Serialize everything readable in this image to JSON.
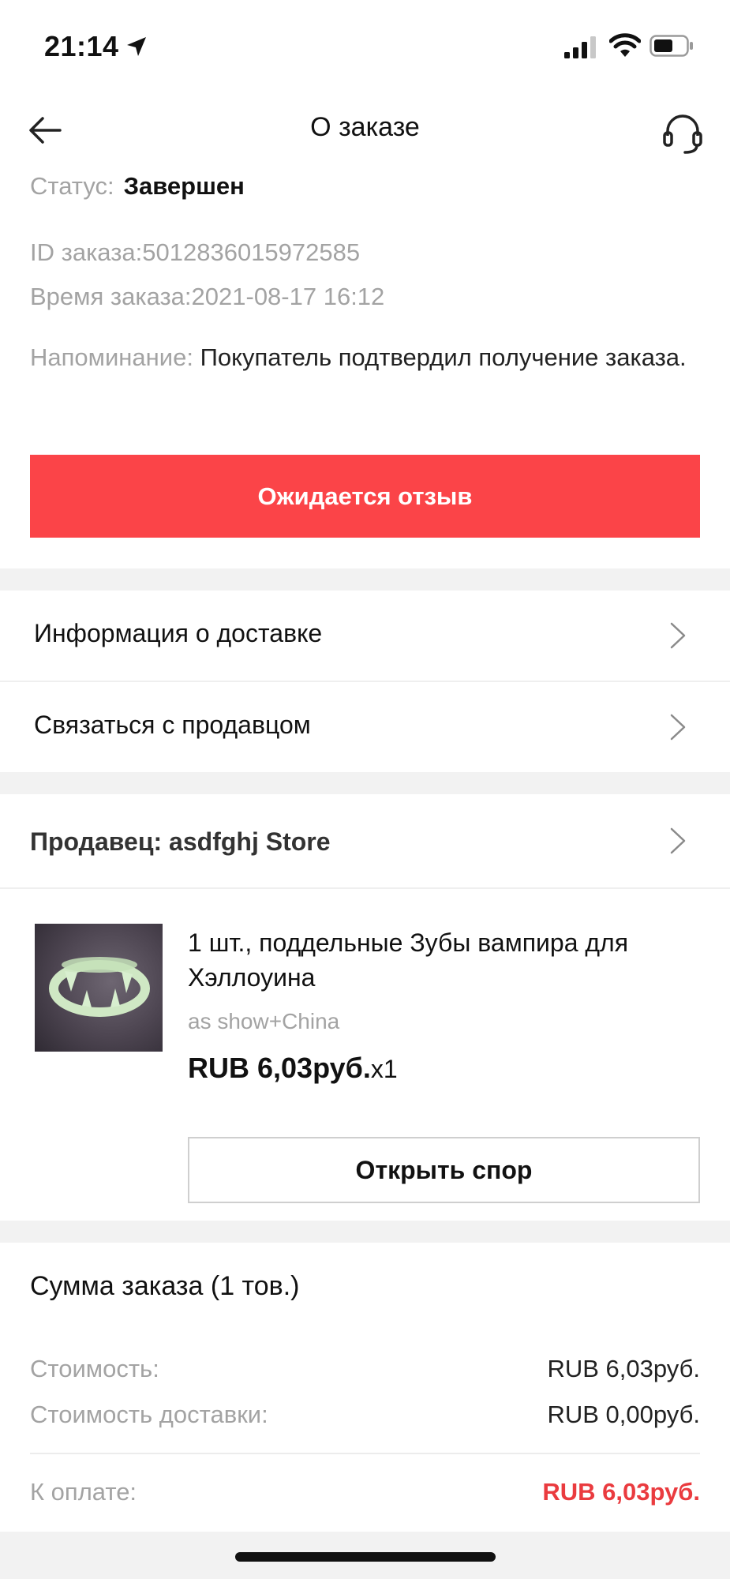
{
  "status_bar": {
    "time": "21:14",
    "icons": [
      "location-arrow-icon",
      "cellular-signal-icon",
      "wifi-icon",
      "battery-icon"
    ]
  },
  "nav": {
    "title": "О заказе",
    "back_icon": "arrow-left-icon",
    "support_icon": "headset-icon"
  },
  "order": {
    "status_label": "Статус:",
    "status_value": "Завершен",
    "id_line": "ID заказа:5012836015972585",
    "time_line": "Время заказа:2021-08-17 16:12",
    "reminder_label": "Напоминание:",
    "reminder_text": "Покупатель подтвердил получение заказа.",
    "review_button": "Ожидается отзыв"
  },
  "links": [
    {
      "label": "Информация о доставке"
    },
    {
      "label": "Связаться с продавцом"
    }
  ],
  "seller": {
    "label": "Продавец: asdfghj Store"
  },
  "product": {
    "title": "1 шт., поддельные Зубы вампира для Хэллоуина",
    "variant": "as show+China",
    "price": "RUB 6,03руб.",
    "quantity": "x1",
    "dispute_button": "Открыть спор"
  },
  "summary": {
    "title": "Сумма заказа (1 тов.)",
    "cost_label": "Стоимость:",
    "cost_value": "RUB 6,03руб.",
    "shipping_label": "Стоимость доставки:",
    "shipping_value": "RUB 0,00руб.",
    "pay_label": "К оплате:",
    "pay_value": "RUB 6,03руб."
  },
  "colors": {
    "accent": "#fb4448",
    "price_red": "#ea3b3f",
    "muted_text": "#a3a3a3",
    "divider": "#f2f2f2"
  }
}
